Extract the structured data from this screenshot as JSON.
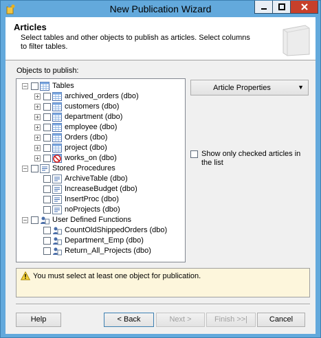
{
  "window": {
    "title": "New Publication Wizard"
  },
  "header": {
    "title": "Articles",
    "description": "Select tables and other objects to publish as articles. Select columns to filter tables."
  },
  "objects_label": "Objects to publish:",
  "tree": {
    "tables_label": "Tables",
    "tables": [
      "archived_orders (dbo)",
      "customers (dbo)",
      "department (dbo)",
      "employee (dbo)",
      "Orders (dbo)",
      "project (dbo)",
      "works_on (dbo)"
    ],
    "procedures_label": "Stored Procedures",
    "procedures": [
      "ArchiveTable (dbo)",
      "IncreaseBudget (dbo)",
      "InsertProc (dbo)",
      "noProjects (dbo)"
    ],
    "functions_label": "User Defined Functions",
    "functions": [
      "CountOldShippedOrders (dbo)",
      "Department_Emp (dbo)",
      "Return_All_Projects (dbo)"
    ]
  },
  "article_properties": "Article Properties",
  "show_checked": "Show only checked articles in the list",
  "message": "You must select at least one object for publication.",
  "buttons": {
    "help": "Help",
    "back": "< Back",
    "next": "Next >",
    "finish": "Finish >>|",
    "cancel": "Cancel"
  }
}
